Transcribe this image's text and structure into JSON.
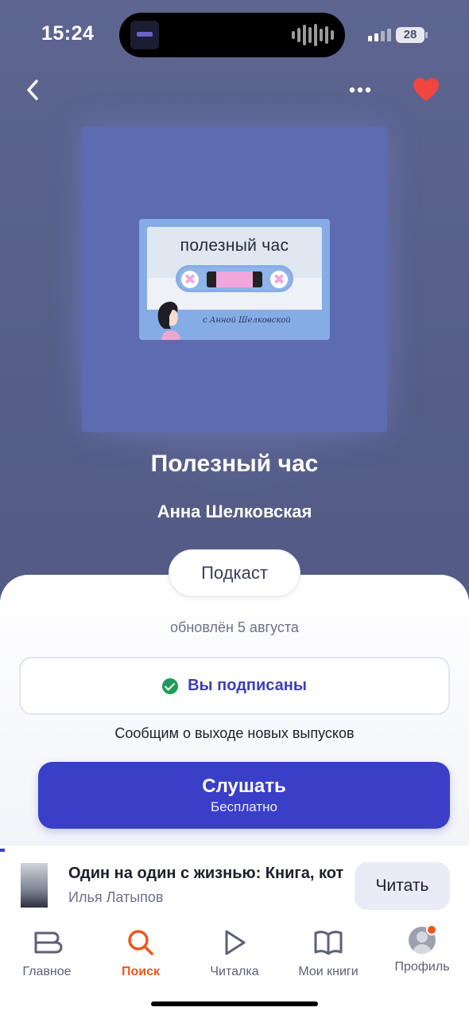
{
  "status_bar": {
    "time": "15:24",
    "battery": "28"
  },
  "podcast": {
    "cover_title": "полезный час",
    "cover_signature": "с Анной Шелковской",
    "title": "Полезный час",
    "author": "Анна Шелковская",
    "type_label": "Подкаст",
    "updated": "обновлён 5 августа",
    "subscribed_label": "Вы подписаны",
    "notify_text": "Сообщим о выходе новых выпусков",
    "listen_label": "Слушать",
    "listen_sub": "Бесплатно"
  },
  "mini_player": {
    "title": "Один на один с жизнью: Книга, кот",
    "author": "Илья Латыпов",
    "action_label": "Читать"
  },
  "tabs": [
    {
      "label": "Главное",
      "icon": "home-icon"
    },
    {
      "label": "Поиск",
      "icon": "search-icon",
      "active": true
    },
    {
      "label": "Читалка",
      "icon": "play-icon"
    },
    {
      "label": "Мои книги",
      "icon": "book-icon"
    },
    {
      "label": "Профиль",
      "icon": "profile-icon"
    }
  ],
  "colors": {
    "background": "#555d88",
    "cover": "#5d6bb1",
    "accent": "#3a3fc8",
    "active_tab": "#f0561c",
    "heart": "#f0463f",
    "check": "#1f9a5a"
  }
}
